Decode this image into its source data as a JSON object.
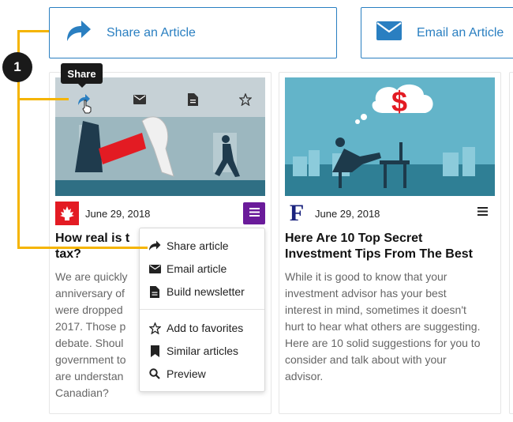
{
  "actions": {
    "share_label": "Share an Article",
    "email_label": "Email an Article"
  },
  "tooltip": "Share",
  "callout": {
    "number": "1"
  },
  "articles": [
    {
      "date": "June 29, 2018",
      "publisher_icon": "maple-leaf-logo",
      "title": "How real is t tax?",
      "title_lines": [
        "How real is t",
        "tax?"
      ],
      "excerpt_lines": [
        "We are quickly",
        "anniversary of",
        "were dropped",
        "2017. Those p",
        "debate. Shoul",
        "government to",
        "are understan",
        "Canadian?"
      ]
    },
    {
      "date": "June 29, 2018",
      "publisher_icon": "f-logo",
      "publisher_letter": "F",
      "title_lines": [
        "Here Are 10 Top Secret",
        "Investment Tips From The Best"
      ],
      "excerpt_lines": [
        "While it is good to know that your",
        "investment advisor has your best",
        "interest in mind, sometimes it doesn't",
        "hurt to hear what others are suggesting.",
        "Here are 10 solid suggestions for you to",
        "consider and talk about with your",
        "advisor."
      ]
    }
  ],
  "dropdown": {
    "items": [
      {
        "label": "Share article",
        "icon": "share-icon"
      },
      {
        "label": "Email article",
        "icon": "envelope-icon"
      },
      {
        "label": "Build newsletter",
        "icon": "document-icon"
      },
      {
        "label": "Add to favorites",
        "icon": "star-icon"
      },
      {
        "label": "Similar articles",
        "icon": "bookmark-icon"
      },
      {
        "label": "Preview",
        "icon": "search-icon"
      }
    ]
  },
  "colors": {
    "accent": "#2a7fc1",
    "menu_purple": "#6a1b9a",
    "callout": "#f5b400",
    "canada_red": "#e31b23",
    "f_navy": "#1a237e"
  }
}
